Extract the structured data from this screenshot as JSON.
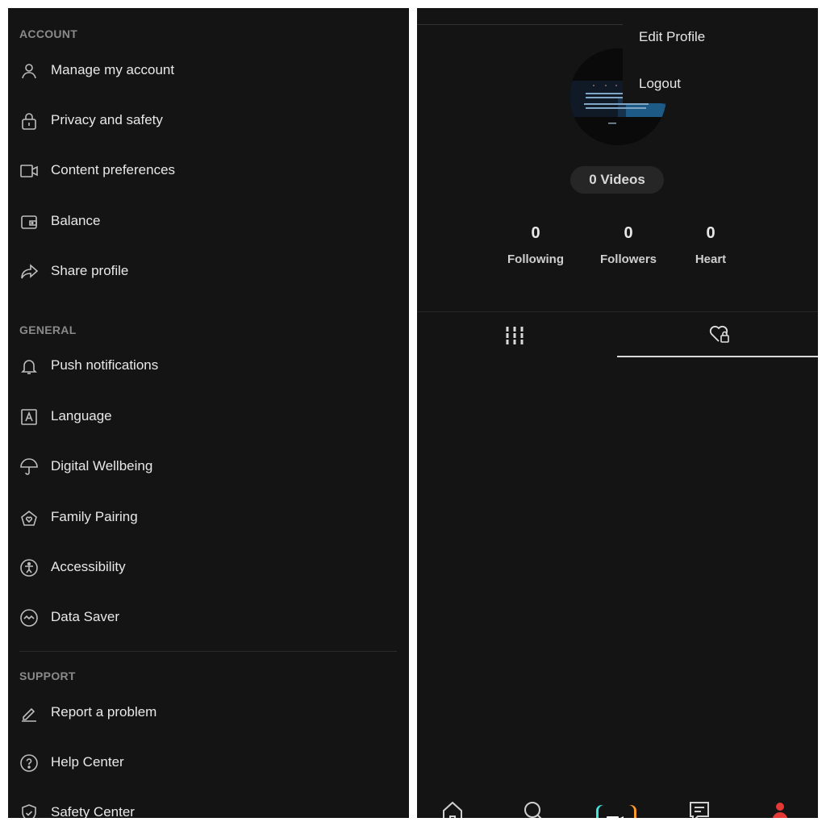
{
  "settings": {
    "sections": [
      {
        "title": "ACCOUNT",
        "items": [
          {
            "label": "Manage my account",
            "icon": "person-icon"
          },
          {
            "label": "Privacy and safety",
            "icon": "lock-icon"
          },
          {
            "label": "Content preferences",
            "icon": "video-icon"
          },
          {
            "label": "Balance",
            "icon": "wallet-icon"
          },
          {
            "label": "Share profile",
            "icon": "share-icon"
          }
        ]
      },
      {
        "title": "GENERAL",
        "items": [
          {
            "label": "Push notifications",
            "icon": "bell-icon"
          },
          {
            "label": "Language",
            "icon": "language-icon"
          },
          {
            "label": "Digital Wellbeing",
            "icon": "umbrella-icon"
          },
          {
            "label": "Family Pairing",
            "icon": "home-heart-icon"
          },
          {
            "label": "Accessibility",
            "icon": "accessibility-icon"
          },
          {
            "label": "Data Saver",
            "icon": "data-saver-icon"
          }
        ]
      },
      {
        "title": "SUPPORT",
        "items": [
          {
            "label": "Report a problem",
            "icon": "pencil-icon"
          },
          {
            "label": "Help Center",
            "icon": "help-icon"
          },
          {
            "label": "Safety Center",
            "icon": "shield-icon"
          }
        ]
      }
    ]
  },
  "profile": {
    "menu": {
      "edit": "Edit Profile",
      "logout": "Logout"
    },
    "videos_pill": "0 Videos",
    "stats": [
      {
        "value": "0",
        "label": "Following"
      },
      {
        "value": "0",
        "label": "Followers"
      },
      {
        "value": "0",
        "label": "Heart"
      }
    ],
    "tabs": [
      {
        "icon": "grid-icon"
      },
      {
        "icon": "liked-locked-icon"
      }
    ],
    "bottom_nav": [
      {
        "icon": "home-icon"
      },
      {
        "icon": "search-icon"
      },
      {
        "icon": "create-icon"
      },
      {
        "icon": "inbox-icon"
      },
      {
        "icon": "profile-icon"
      }
    ],
    "colors": {
      "active_profile": "#e53935",
      "create_cyan": "#3ee8e0",
      "create_orange": "#ff9b2e"
    }
  }
}
